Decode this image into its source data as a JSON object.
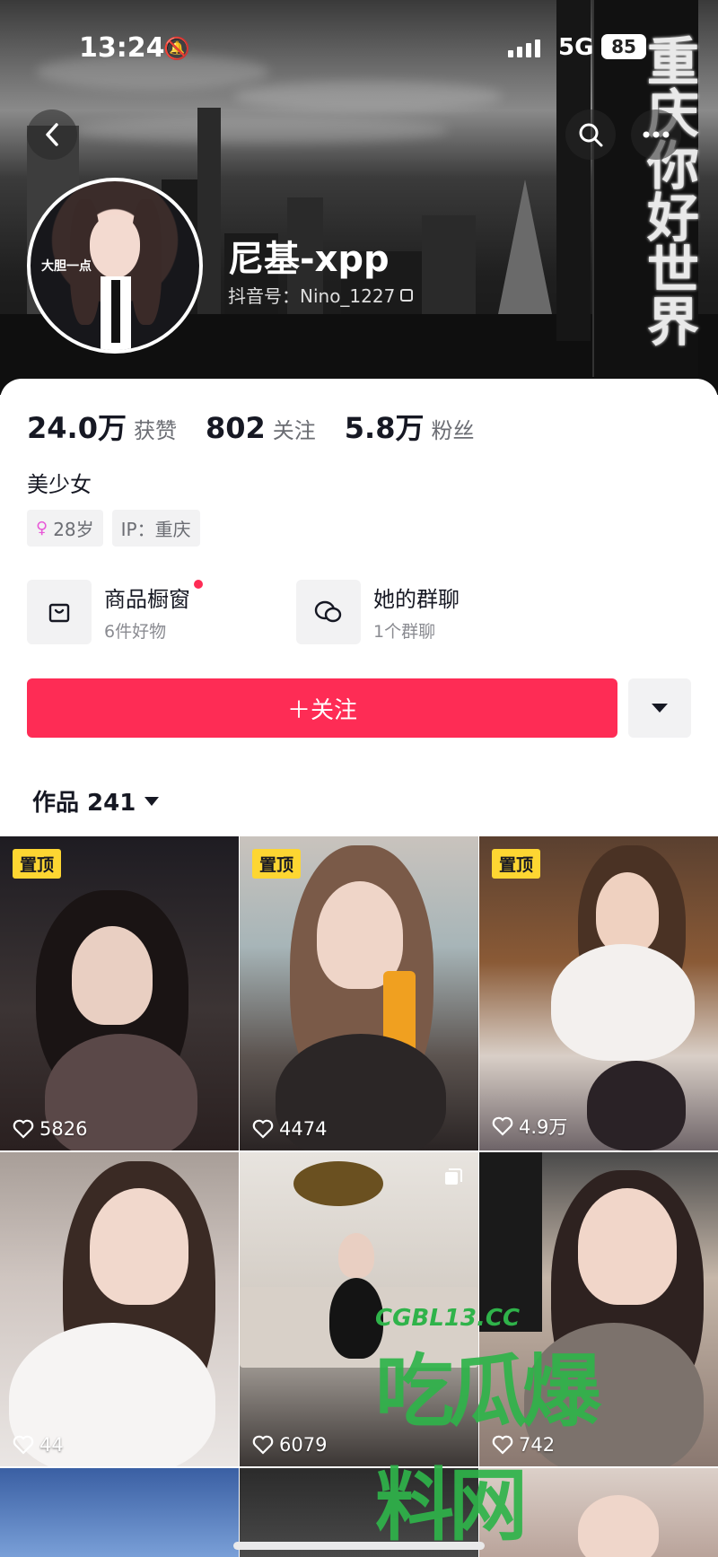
{
  "status_bar": {
    "time": "13:24",
    "network": "5G",
    "battery": "85"
  },
  "cover_banner": {
    "tower_text": "重庆你好世界"
  },
  "header": {
    "avatar_caption": "大胆一点",
    "name": "尼基-xpp",
    "douyin_id": "抖音号：Nino_1227"
  },
  "stats": [
    {
      "value": "24.0万",
      "label": "获赞"
    },
    {
      "value": "802",
      "label": "关注"
    },
    {
      "value": "5.8万",
      "label": "粉丝"
    }
  ],
  "bio": "美少女",
  "tags": {
    "age": "28岁",
    "ip": "IP：重庆"
  },
  "services": [
    {
      "title": "商品橱窗",
      "subtitle": "6件好物",
      "icon": "shopping-bag-icon",
      "has_dot": true
    },
    {
      "title": "她的群聊",
      "subtitle": "1个群聊",
      "icon": "chat-bubbles-icon",
      "has_dot": false
    }
  ],
  "follow_button": "＋关注",
  "works_tab": "作品 241",
  "pinned_label": "置顶",
  "videos": [
    {
      "likes": "5826",
      "pinned": true
    },
    {
      "likes": "4474",
      "pinned": true
    },
    {
      "likes": "4.9万",
      "pinned": true
    },
    {
      "likes": "44",
      "pinned": false
    },
    {
      "likes": "6079",
      "pinned": false,
      "multi_image": true
    },
    {
      "likes": "742",
      "pinned": false
    }
  ],
  "watermark": {
    "url": "CGBL13.CC",
    "logo": "吃瓜爆料网"
  },
  "colors": {
    "accent": "#fe2c55",
    "pin_badge": "#fdd632",
    "text_primary": "#161823",
    "text_secondary": "#6b6d73"
  }
}
